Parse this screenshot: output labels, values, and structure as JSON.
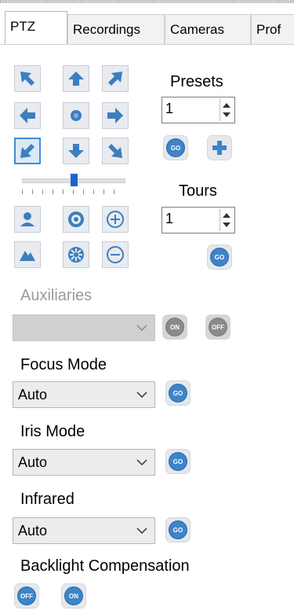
{
  "tabs": [
    "PTZ",
    "Recordings",
    "Cameras",
    "Prof"
  ],
  "ptz": {
    "presets_label": "Presets",
    "preset_value": "1",
    "tours_label": "Tours",
    "tour_value": "1"
  },
  "aux": {
    "label": "Auxiliaries",
    "on_label": "ON",
    "off_label": "OFF"
  },
  "focus": {
    "label": "Focus Mode",
    "value": "Auto"
  },
  "iris": {
    "label": "Iris Mode",
    "value": "Auto"
  },
  "infrared": {
    "label": "Infrared",
    "value": "Auto"
  },
  "backlight": {
    "label": "Backlight Compensation",
    "off_label": "OFF",
    "on_label": "ON"
  },
  "go_label": "GO",
  "speed_slider": {
    "value": 0.5
  },
  "colors": {
    "accent": "#3e84c8",
    "disabled": "#9b9b9b"
  }
}
